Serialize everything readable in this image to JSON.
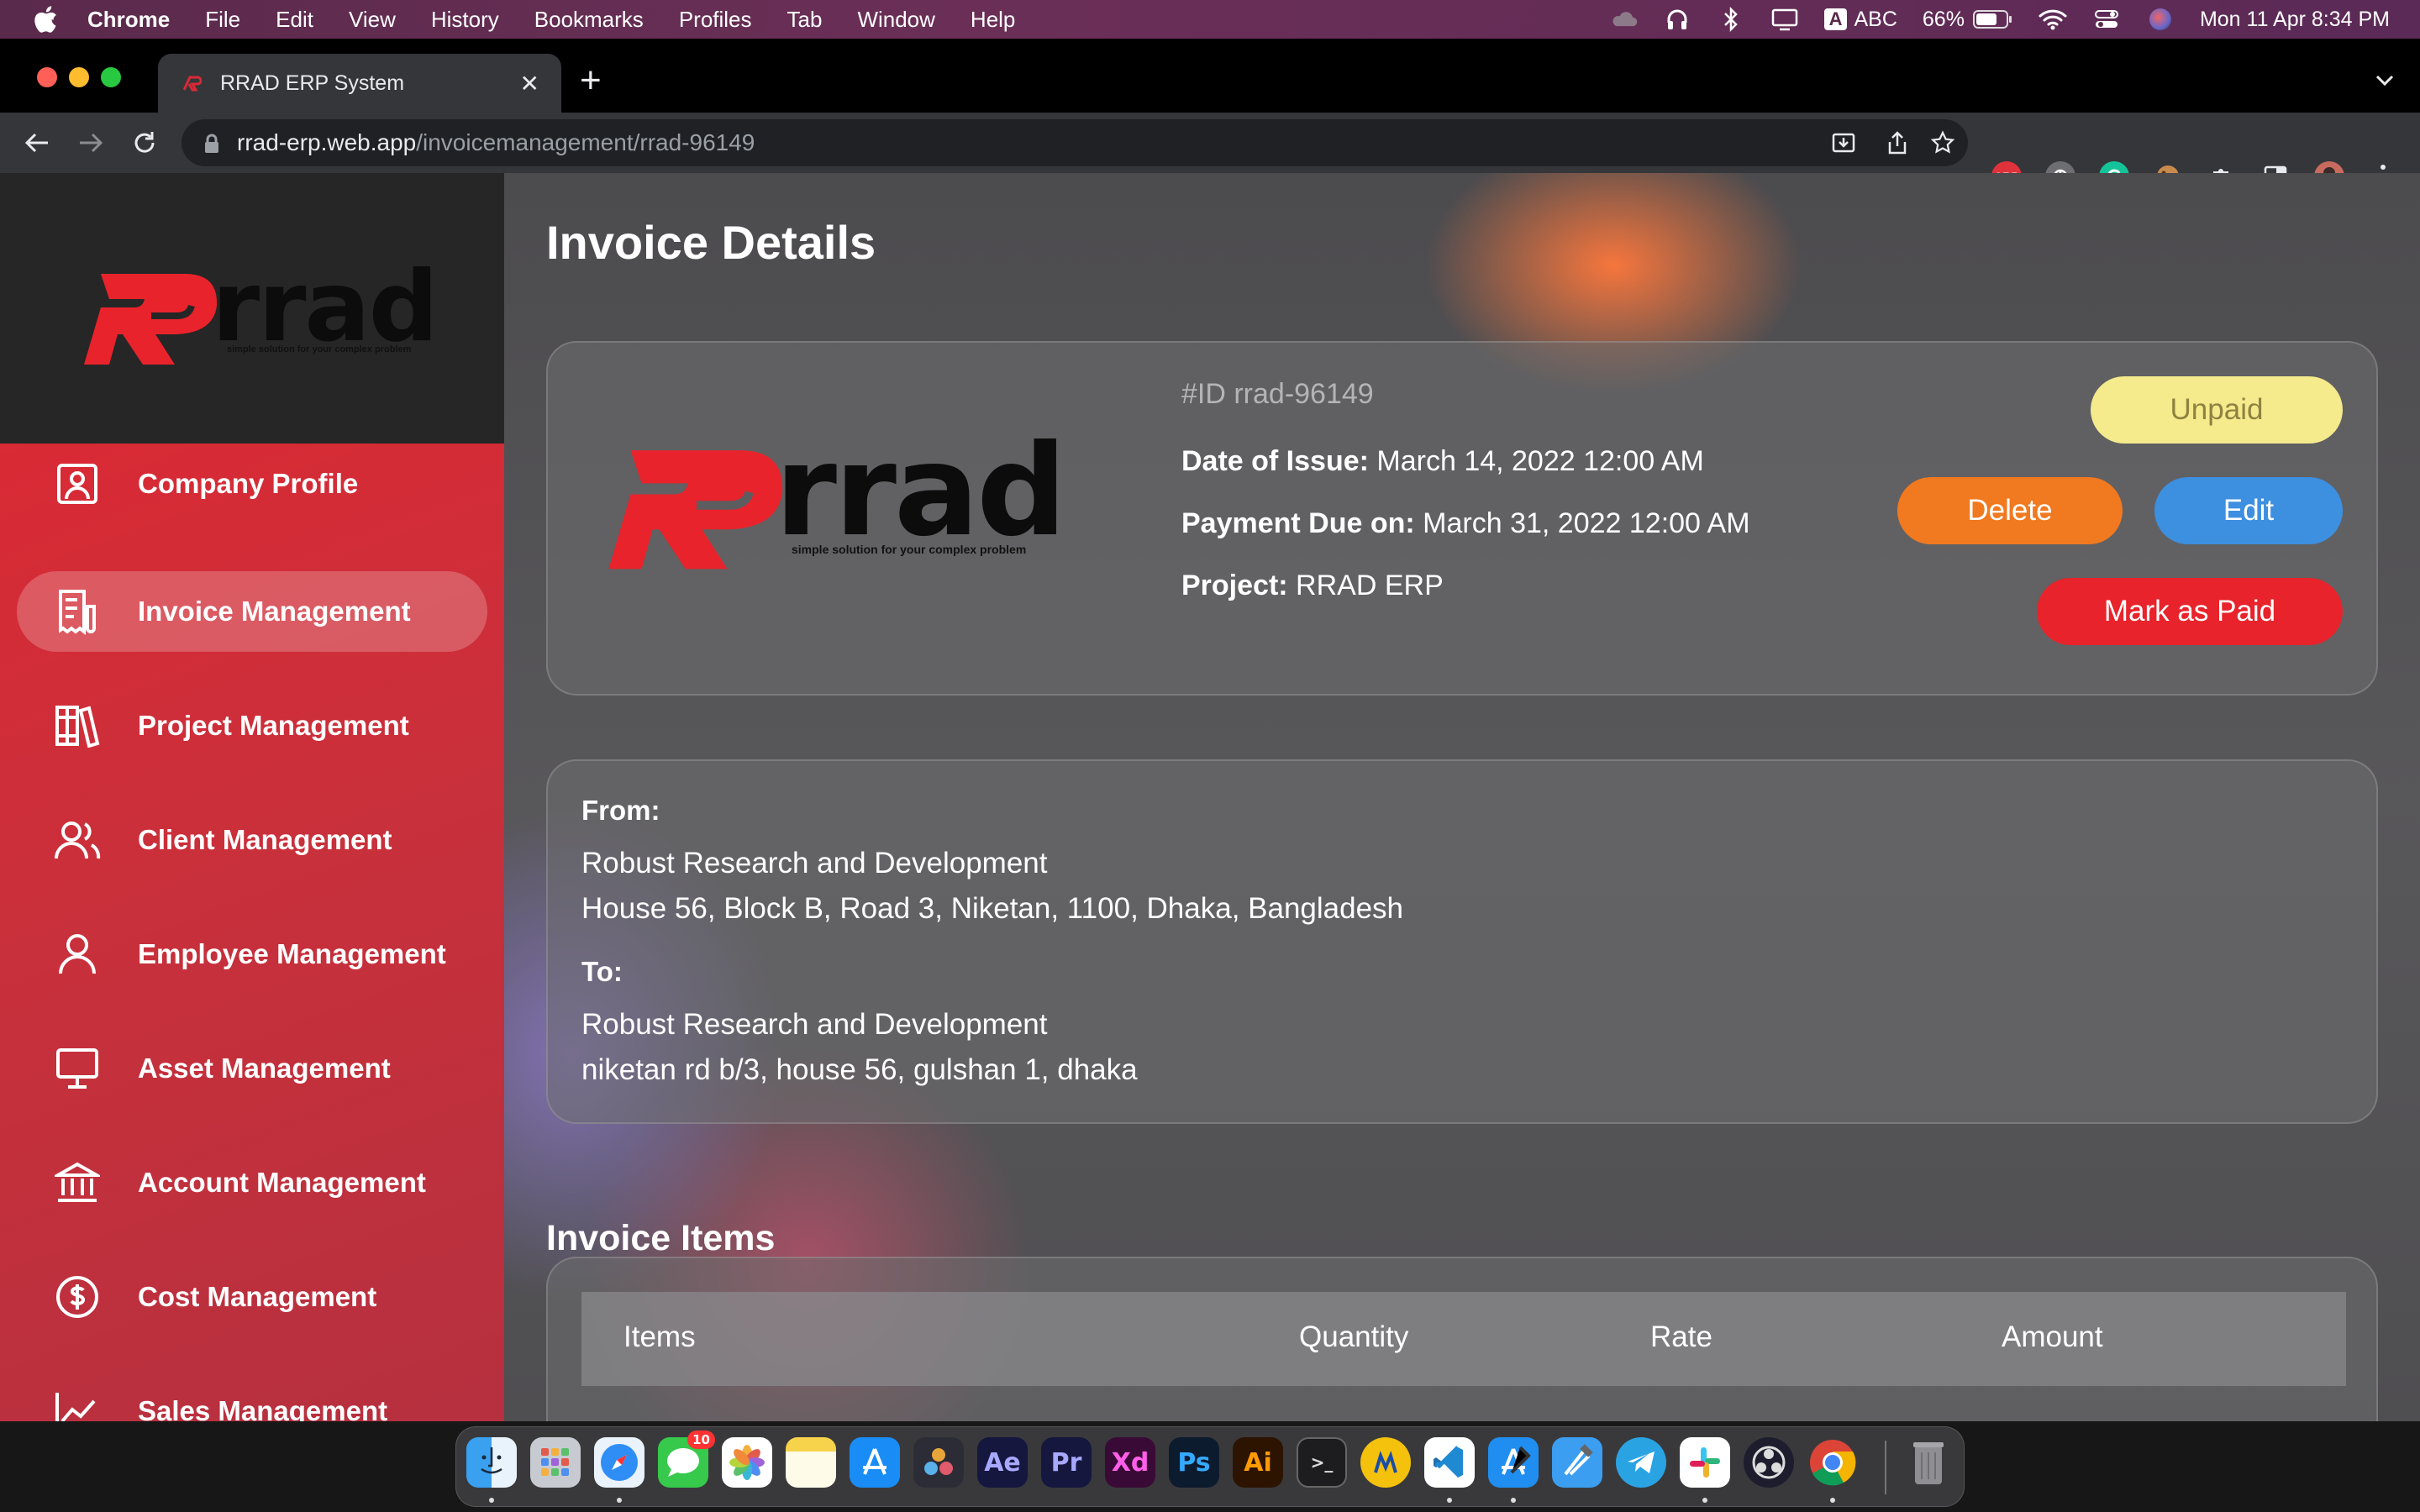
{
  "menubar": {
    "app_name": "Chrome",
    "items": [
      "File",
      "Edit",
      "View",
      "History",
      "Bookmarks",
      "Profiles",
      "Tab",
      "Window",
      "Help"
    ],
    "input_source": "ABC",
    "battery": "66%",
    "datetime": "Mon 11 Apr  8:34 PM"
  },
  "browser": {
    "tab_title": "RRAD ERP System",
    "url_host": "rrad-erp.web.app",
    "url_path": "/invoicemanagement/rrad-96149",
    "extensions": {
      "abp": "ABP"
    }
  },
  "sidebar": {
    "brand": "rrad",
    "tagline": "simple solution for your complex problem",
    "items": [
      {
        "label": "Company Profile",
        "icon": "profile-card-icon"
      },
      {
        "label": "Invoice Management",
        "icon": "invoice-icon",
        "active": true
      },
      {
        "label": "Project Management",
        "icon": "books-icon"
      },
      {
        "label": "Client Management",
        "icon": "users-icon"
      },
      {
        "label": "Employee Management",
        "icon": "user-icon"
      },
      {
        "label": "Asset Management",
        "icon": "monitor-icon"
      },
      {
        "label": "Account Management",
        "icon": "bank-icon"
      },
      {
        "label": "Cost Management",
        "icon": "dollar-icon"
      },
      {
        "label": "Sales Management",
        "icon": "chart-icon"
      }
    ]
  },
  "invoice": {
    "page_title": "Invoice Details",
    "id_label": "#ID rrad-96149",
    "issue_label": "Date of Issue:",
    "issue_value": "March 14, 2022 12:00 AM",
    "due_label": "Payment Due on:",
    "due_value": "March 31, 2022 12:00 AM",
    "project_label": "Project:",
    "project_value": "RRAD ERP",
    "status": "Unpaid",
    "delete_label": "Delete",
    "edit_label": "Edit",
    "mark_paid_label": "Mark as Paid",
    "logo_brand": "rrad",
    "logo_tagline": "simple solution for your complex problem"
  },
  "addresses": {
    "from_label": "From:",
    "from_name": "Robust Research and Development",
    "from_address": "House 56, Block B, Road 3, Niketan, 1100, Dhaka, Bangladesh",
    "to_label": "To:",
    "to_name": "Robust Research and Development",
    "to_address": "niketan rd b/3,  house 56, gulshan 1, dhaka"
  },
  "items_section": {
    "title": "Invoice Items",
    "columns": [
      "Items",
      "Quantity",
      "Rate",
      "Amount"
    ]
  },
  "dock": {
    "messages_badge": "10",
    "apps": [
      "Finder",
      "Launchpad",
      "Safari",
      "Messages",
      "Photos",
      "Notes",
      "App Store",
      "DaVinci Resolve",
      "After Effects",
      "Premiere Pro",
      "Adobe XD",
      "Photoshop",
      "Illustrator",
      "Terminal",
      "Visual Studio Code",
      "Xcode",
      "Telegram",
      "Slack",
      "OBS",
      "Chrome",
      "Trash"
    ]
  },
  "colors": {
    "accent_red": "#e8232b",
    "unpaid_bg": "#f5ea8c",
    "delete_bg": "#f1791f",
    "edit_bg": "#3d8fe0"
  }
}
